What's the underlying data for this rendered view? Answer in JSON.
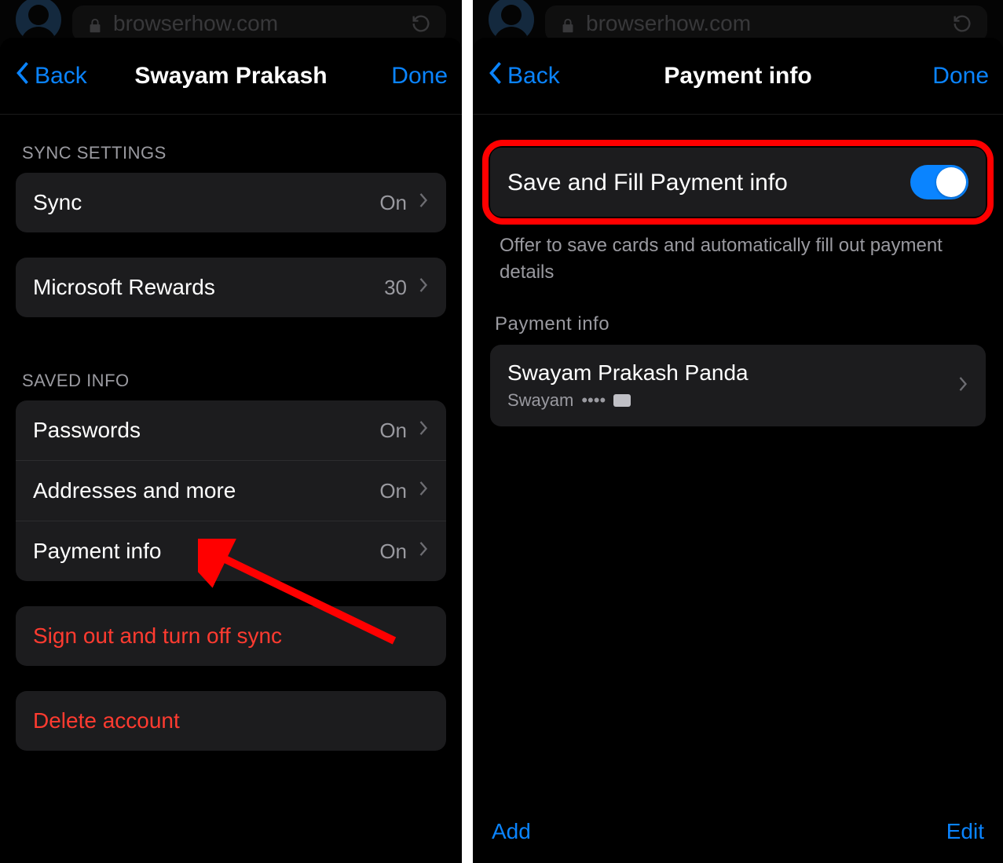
{
  "shared": {
    "url": "browserhow.com",
    "back_label": "Back",
    "done_label": "Done",
    "on_value": "On"
  },
  "left": {
    "title": "Swayam Prakash",
    "section_sync_header": "SYNC SETTINGS",
    "sync_label": "Sync",
    "rewards_label": "Microsoft Rewards",
    "rewards_value": "30",
    "section_saved_header": "SAVED INFO",
    "passwords_label": "Passwords",
    "addresses_label": "Addresses and more",
    "payment_label": "Payment info",
    "signout_label": "Sign out and turn off sync",
    "delete_label": "Delete account"
  },
  "right": {
    "title": "Payment info",
    "toggle_label": "Save and Fill Payment info",
    "toggle_on": true,
    "toggle_note": "Offer to save cards and automatically fill out payment details",
    "list_header": "Payment info",
    "card_name": "Swayam Prakash Panda",
    "card_sub_name": "Swayam",
    "card_dots": "••••",
    "add_label": "Add",
    "edit_label": "Edit"
  },
  "colors": {
    "accent": "#0a84ff",
    "danger": "#ff3b30",
    "annotation": "#ff0000"
  }
}
